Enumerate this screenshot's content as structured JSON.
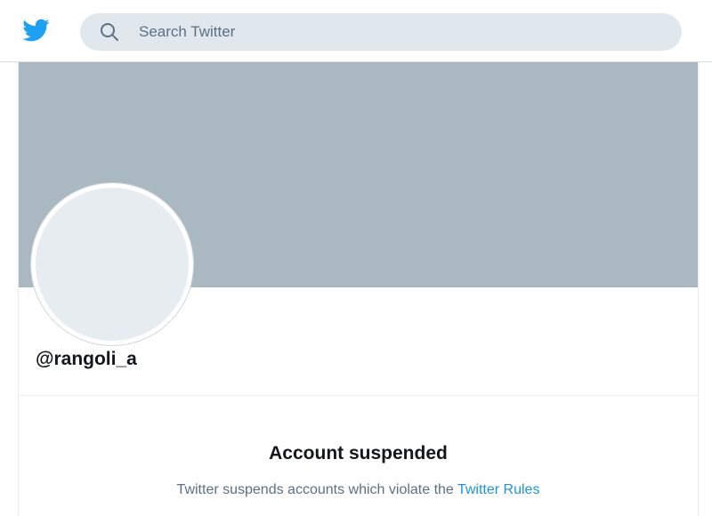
{
  "header": {
    "logo_icon": "twitter-bird-icon",
    "brand_color": "#1da1f2",
    "search": {
      "icon": "search-icon",
      "placeholder": "Search Twitter",
      "value": ""
    }
  },
  "profile": {
    "banner_color": "#aab8c2",
    "handle": "@rangoli_a",
    "status_title": "Account suspended",
    "status_text": "Twitter suspends accounts which violate the",
    "rules_link": "Twitter Rules",
    "link_color": "#1b95e0"
  }
}
